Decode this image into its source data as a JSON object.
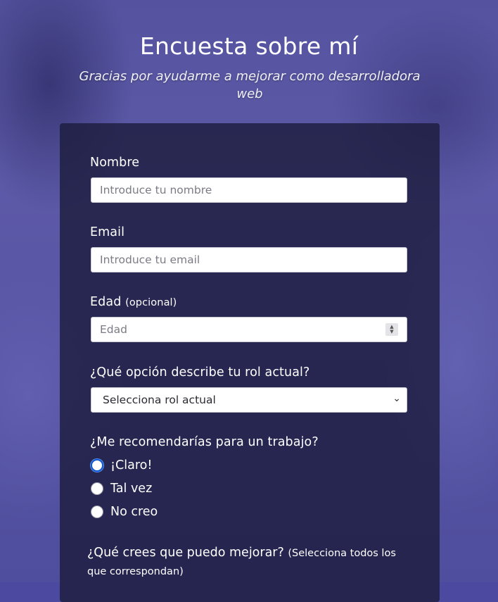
{
  "header": {
    "title": "Encuesta sobre mí",
    "subtitle": "Gracias por ayudarme a mejorar como desarrolladora web"
  },
  "form": {
    "name": {
      "label": "Nombre",
      "placeholder": "Introduce tu nombre"
    },
    "email": {
      "label": "Email",
      "placeholder": "Introduce tu email"
    },
    "age": {
      "label": "Edad",
      "optional_note": "(opcional)",
      "placeholder": "Edad"
    },
    "role": {
      "label": "¿Qué opción describe tu rol actual?",
      "selected": "Selecciona rol actual"
    },
    "recommend": {
      "label": "¿Me recomendarías para un trabajo?",
      "options": [
        "¡Claro!",
        "Tal vez",
        "No creo"
      ],
      "selected_index": 0
    },
    "improve": {
      "label": "¿Qué crees que puedo mejorar?",
      "note": "(Selecciona todos los que correspondan)"
    }
  },
  "colors": {
    "card": "#1b1b3c",
    "accent": "#0b57d0",
    "background": "#5654a3"
  }
}
